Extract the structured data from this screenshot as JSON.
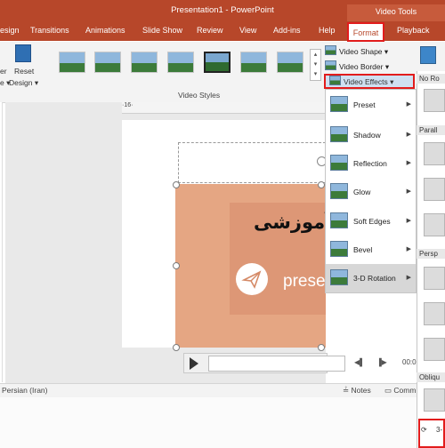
{
  "title": "Presentation1  -  PowerPoint",
  "context_tab_group": "Video Tools",
  "tabs": [
    "esign",
    "Transitions",
    "Animations",
    "Slide Show",
    "Review",
    "View",
    "Add-ins",
    "Help",
    "Format",
    "Playback"
  ],
  "ribbon": {
    "left_group": [
      "er",
      "e ▾",
      "Reset",
      "Design ▾"
    ],
    "group_label": "Video Styles",
    "video_shape": "Video Shape ▾",
    "video_border": "Video Border ▾",
    "video_effects": "Video Effects ▾"
  },
  "ruler_label": "·16·",
  "slide": {
    "title": "آموزشی",
    "logo_text": "prese"
  },
  "status": {
    "language": "Persian (Iran)",
    "notes": "Notes",
    "comments": "Comm"
  },
  "player_time": "00:0",
  "effects_menu": [
    "Preset",
    "Shadow",
    "Reflection",
    "Glow",
    "Soft Edges",
    "Bevel",
    "3-D Rotation"
  ],
  "gallery_headers": [
    "No Ro",
    "Parall",
    "Persp",
    "Obliqu"
  ],
  "options_text": "3-"
}
